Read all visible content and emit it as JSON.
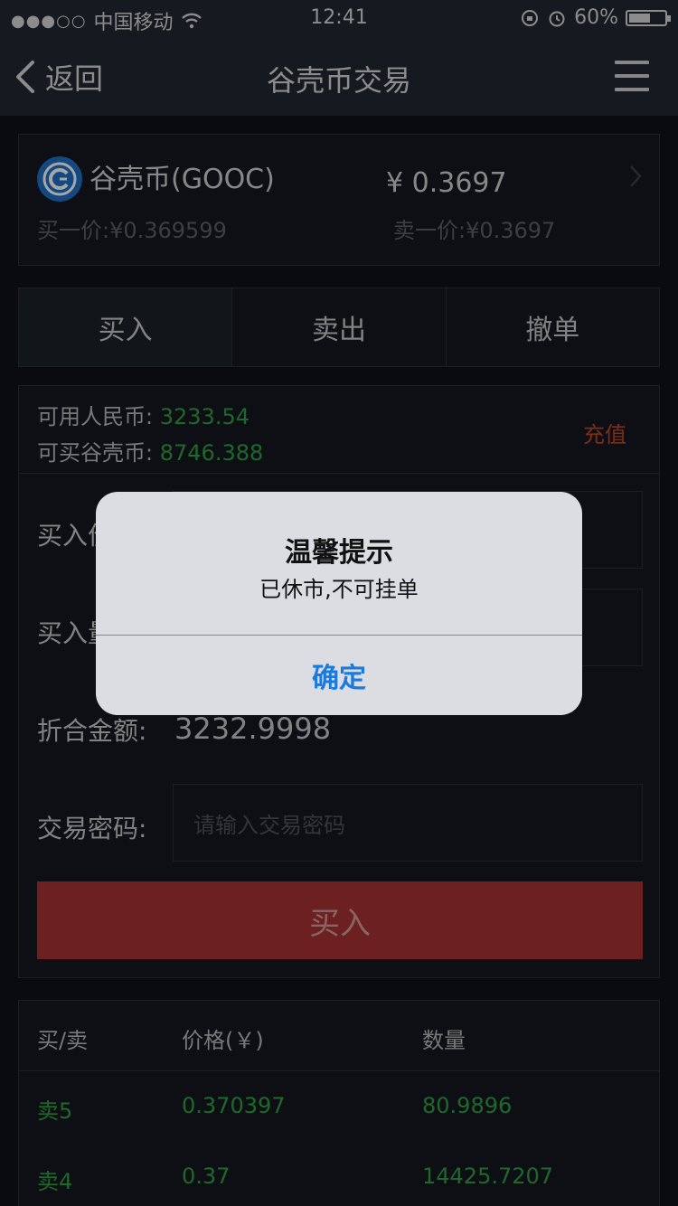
{
  "status_bar": {
    "signal": "●●●○○",
    "carrier": "中国移动",
    "time": "12:41",
    "battery_text": "60%",
    "battery_level": 0.6
  },
  "nav": {
    "back_label": "返回",
    "title": "谷壳币交易",
    "menu_icon": "hamburger-icon"
  },
  "coin": {
    "logo_icon": "gooc-coin-icon",
    "name": "谷壳币(GOOC)",
    "price": "¥ 0.3697",
    "bid": "买一价:¥0.369599",
    "ask": "卖一价:¥0.3697"
  },
  "tabs": [
    {
      "label": "买入",
      "active": true
    },
    {
      "label": "卖出",
      "active": false
    },
    {
      "label": "撤单",
      "active": false
    }
  ],
  "balance": {
    "rmb_label": "可用人民币:",
    "rmb_value": "3233.54",
    "coin_label": "可买谷壳币:",
    "coin_value": "8746.388",
    "recharge_label": "充值"
  },
  "form": {
    "price_label": "买入价",
    "qty_label": "买入量",
    "amount_label": "折合金额:",
    "amount_value": "3232.9998",
    "password_label": "交易密码:",
    "password_placeholder": "请输入交易密码",
    "submit_label": "买入"
  },
  "order_book": {
    "headers": [
      "买/卖",
      "价格(￥)",
      "数量"
    ],
    "rows": [
      {
        "side": "卖5",
        "price": "0.370397",
        "qty": "80.9896"
      },
      {
        "side": "卖4",
        "price": "0.37",
        "qty": "14425.7207"
      }
    ]
  },
  "dialog": {
    "title": "温馨提示",
    "message": "已休市,不可挂单",
    "button": "确定"
  },
  "colors": {
    "background": "#101218",
    "bar": "#222731",
    "green": "#2ea043",
    "orange": "#c2471d",
    "buy_button": "#a83232",
    "dialog_blue": "#1a7ae0"
  }
}
